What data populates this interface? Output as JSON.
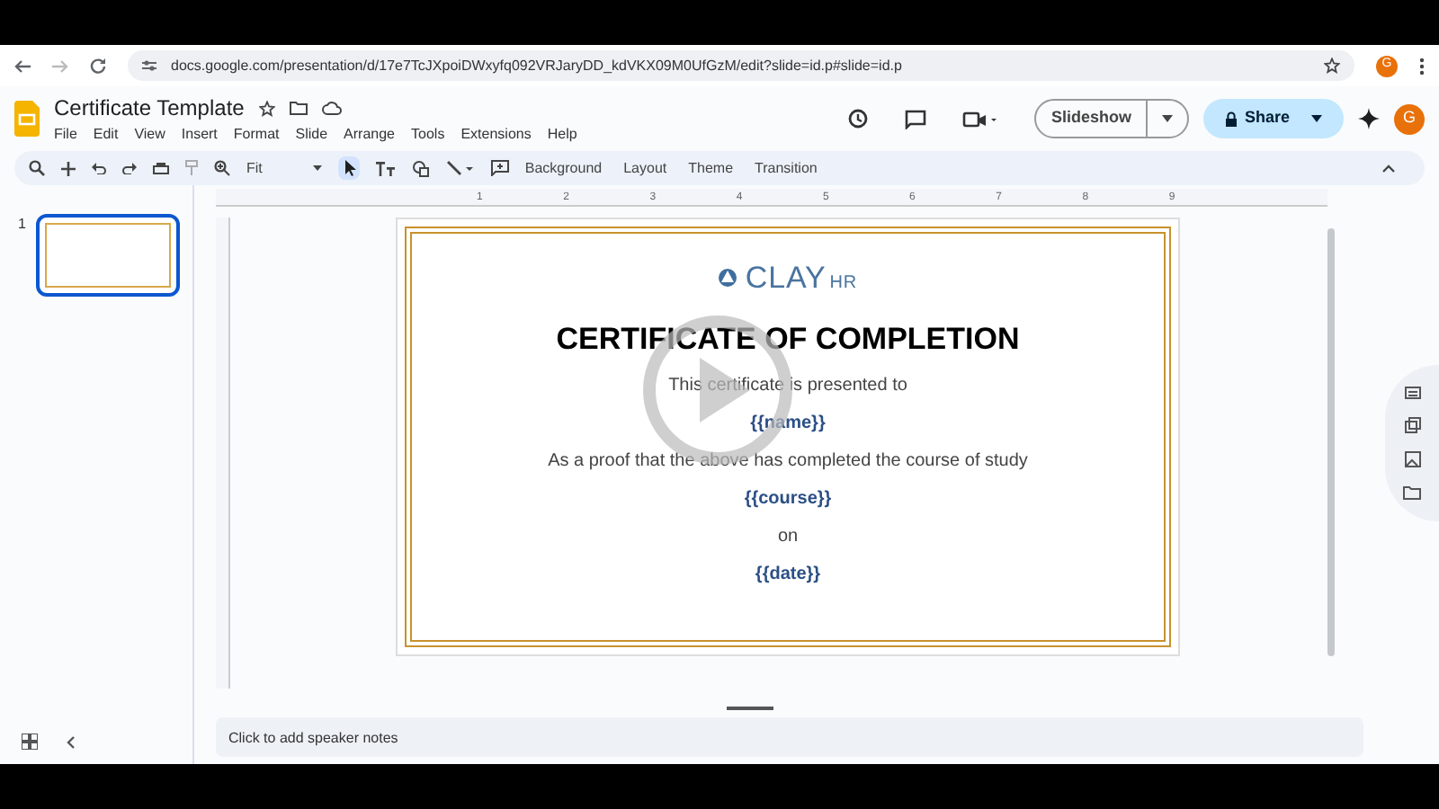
{
  "browser": {
    "url": "docs.google.com/presentation/d/17e7TcJXpoiDWxyfq092VRJaryDD_kdVKX09M0UfGzM/edit?slide=id.p#slide=id.p",
    "profile_initial": "G"
  },
  "document": {
    "title": "Certificate Template",
    "account_initial": "G"
  },
  "menu": [
    "File",
    "Edit",
    "View",
    "Insert",
    "Format",
    "Slide",
    "Arrange",
    "Tools",
    "Extensions",
    "Help"
  ],
  "header_buttons": {
    "slideshow": "Slideshow",
    "share": "Share"
  },
  "toolbar": {
    "zoom": "Fit",
    "actions": [
      "Background",
      "Layout",
      "Theme",
      "Transition"
    ]
  },
  "ruler": [
    "1",
    "2",
    "3",
    "4",
    "5",
    "6",
    "7",
    "8",
    "9"
  ],
  "filmstrip": [
    {
      "number": "1",
      "selected": true
    }
  ],
  "slide": {
    "logo_main": "CLAY",
    "logo_suffix": "HR",
    "title": "CERTIFICATE OF COMPLETION",
    "lines": [
      {
        "kind": "plain",
        "text": "This certificate is presented to"
      },
      {
        "kind": "field",
        "text": "{{name}}"
      },
      {
        "kind": "plain",
        "text": "As a proof that the above has completed the course of study"
      },
      {
        "kind": "field",
        "text": "{{course}}"
      },
      {
        "kind": "plain",
        "text": "on"
      },
      {
        "kind": "field",
        "text": "{{date}}"
      }
    ]
  },
  "speaker_notes": {
    "placeholder": "Click to add speaker notes"
  }
}
